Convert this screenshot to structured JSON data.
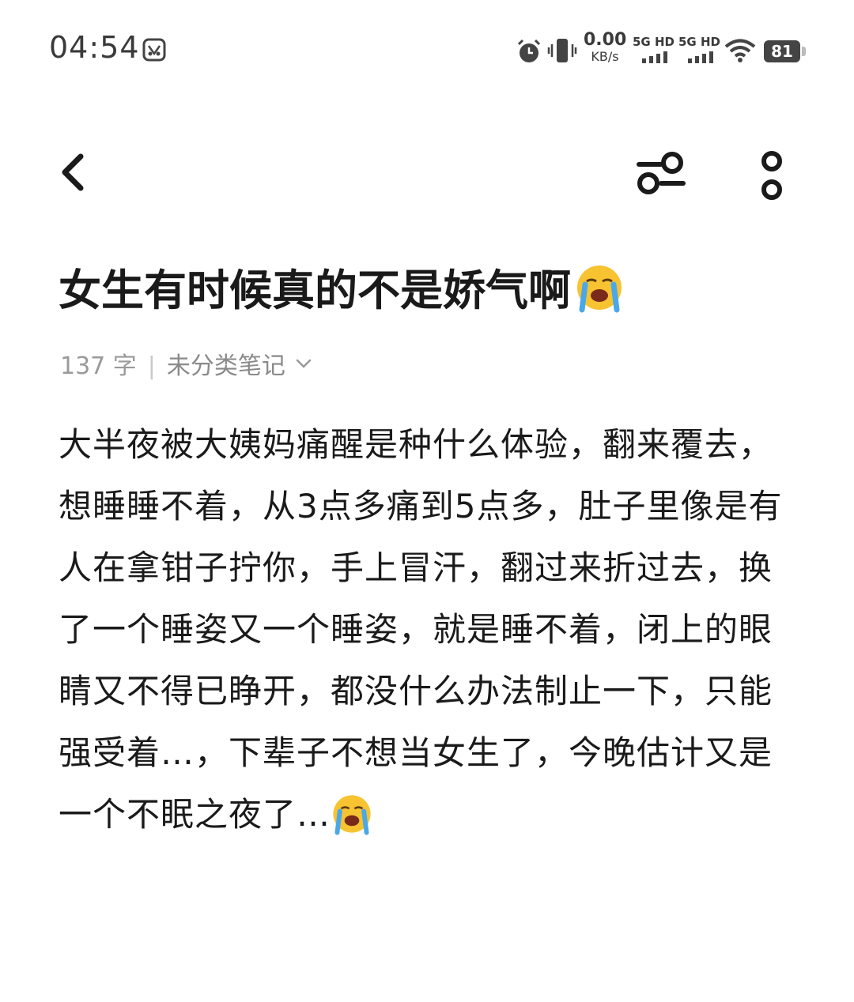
{
  "status_bar": {
    "time": "04:54",
    "net_speed_value": "0.00",
    "net_speed_unit": "KB/s",
    "sim1_label": "5G HD",
    "sim2_label": "5G HD",
    "battery_level": "81",
    "icons": [
      "notification-app-icon",
      "alarm-icon",
      "vibrate-icon",
      "signal-icon",
      "signal-icon",
      "wifi-icon",
      "battery-icon"
    ]
  },
  "toolbar": {
    "icons": [
      "back-icon",
      "settings-sliders-icon",
      "more-vertical-icon"
    ]
  },
  "note": {
    "title": "女生有时候真的不是娇气啊",
    "title_emoji": "loudly-crying-emoji",
    "word_count": "137 字",
    "separator": "|",
    "category": "未分类笔记",
    "body": "大半夜被大姨妈痛醒是种什么体验，翻来覆去，想睡睡不着，从3点多痛到5点多，肚子里像是有人在拿钳子拧你，手上冒汗，翻过来折过去，换了一个睡姿又一个睡姿，就是睡不着，闭上的眼睛又不得已睁开，都没什么办法制止一下，只能强受着…，下辈子不想当女生了，今晚估计又是一个不眠之夜了…",
    "body_emoji": "loudly-crying-emoji"
  },
  "colors": {
    "text": "#1a1a1a",
    "meta": "#9a9a9a",
    "background": "#ffffff",
    "battery": "#444444"
  }
}
